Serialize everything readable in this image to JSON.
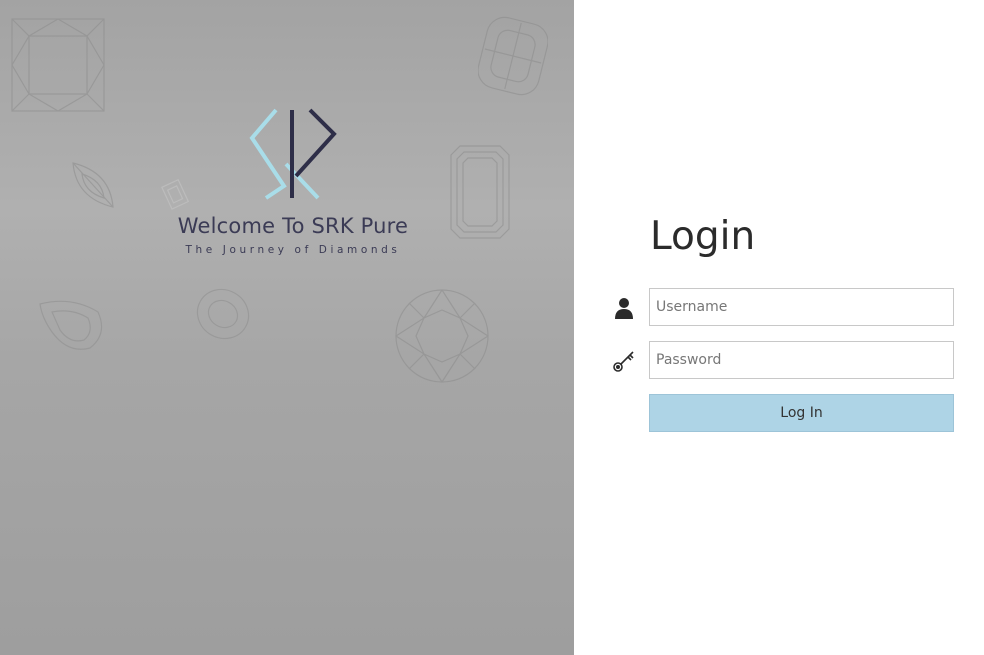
{
  "brand": {
    "welcome": "Welcome To SRK Pure",
    "tagline": "The Journey of Diamonds",
    "logo_colors": {
      "light": "#a9dde9",
      "dark": "#2e2e48"
    }
  },
  "login": {
    "title": "Login",
    "username": {
      "value": "",
      "placeholder": "Username",
      "icon": "user-icon"
    },
    "password": {
      "value": "",
      "placeholder": "Password",
      "icon": "key-icon"
    },
    "submit_label": "Log In",
    "button_color": "#aed4e6"
  },
  "background_gems": [
    "princess-cut",
    "cushion-cut",
    "marquise-cut",
    "emerald-cut",
    "pear-cut",
    "oval-cut",
    "round-brilliant-cut"
  ]
}
